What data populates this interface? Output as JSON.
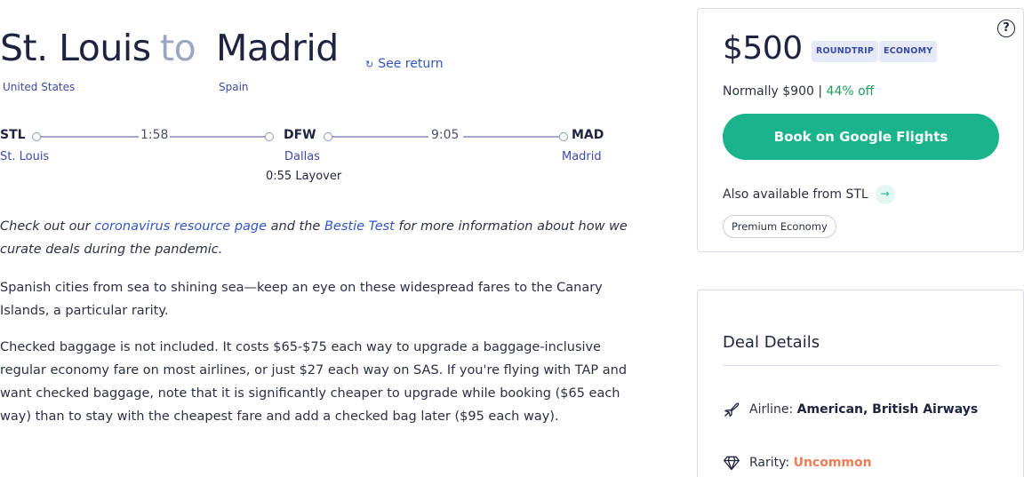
{
  "route": {
    "origin_city": "St. Louis",
    "connector": "to",
    "destination_city": "Madrid",
    "origin_country": "United States",
    "destination_country": "Spain",
    "see_return": "See return"
  },
  "itinerary": {
    "stops": [
      {
        "code": "STL",
        "city": "St. Louis"
      },
      {
        "code": "DFW",
        "city": "Dallas"
      },
      {
        "code": "MAD",
        "city": "Madrid"
      }
    ],
    "durations": [
      "1:58",
      "9:05"
    ],
    "layover": "0:55 Layover"
  },
  "content": {
    "notice_prefix": "Check out our ",
    "notice_link1": "coronavirus resource page",
    "notice_mid": " and the ",
    "notice_link2": "Bestie Test",
    "notice_suffix": " for more information about how we curate deals during the pandemic.",
    "paragraph1": "Spanish cities from sea to shining sea—keep an eye on these widespread fares to the Canary Islands, a particular rarity.",
    "paragraph2": "Checked baggage is not included. It costs $65-$75 each way to upgrade a baggage-inclusive regular economy fare on most airlines, or just $27 each way on SAS. If you're flying with TAP and want checked baggage, note that it is significantly cheaper to upgrade while booking ($65 each way) than to stay with the cheapest fare and add a checked bag later ($95 each way)."
  },
  "price_card": {
    "help_symbol": "?",
    "price": "$500",
    "badge_trip": "ROUNDTRIP",
    "badge_class": "ECONOMY",
    "normally": "Normally $900",
    "separator": " | ",
    "discount": "44% off",
    "book_label": "Book on Google Flights",
    "also_available": "Also available from STL",
    "chip": "Premium Economy"
  },
  "deal_details": {
    "title": "Deal Details",
    "airline_label": "Airline: ",
    "airline_value": "American, British Airways",
    "rarity_label": "Rarity: ",
    "rarity_value": "Uncommon"
  },
  "colors": {
    "accent_green": "#1ab38b",
    "link_blue": "#3056c5",
    "discount_green": "#1a9d5b",
    "rarity_orange": "#ee7d54"
  },
  "icons": [
    "refresh-icon",
    "help-icon",
    "arrow-right-icon",
    "plane-icon",
    "diamond-icon"
  ]
}
